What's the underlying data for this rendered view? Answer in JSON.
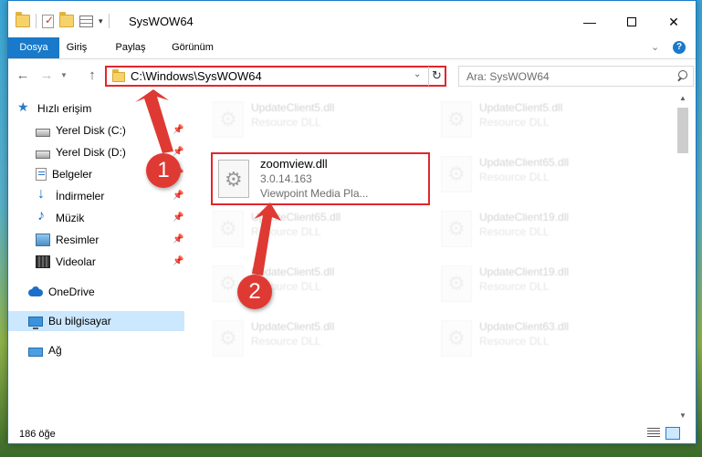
{
  "window": {
    "title": "SysWOW64",
    "controls": {
      "minimize": "—",
      "close": "✕"
    }
  },
  "ribbon": {
    "tabs": [
      {
        "label": "Dosya"
      },
      {
        "label": "Giriş"
      },
      {
        "label": "Paylaş"
      },
      {
        "label": "Görünüm"
      }
    ],
    "help": "?"
  },
  "address": {
    "path": "C:\\Windows\\SysWOW64"
  },
  "search": {
    "placeholder": "Ara: SysWOW64"
  },
  "sidebar": {
    "items": [
      {
        "label": "Hızlı erişim",
        "icon": "star-icon"
      },
      {
        "label": "Yerel Disk (C:)",
        "icon": "drive-icon",
        "pinned": true
      },
      {
        "label": "Yerel Disk (D:)",
        "icon": "drive-icon",
        "pinned": true
      },
      {
        "label": "Belgeler",
        "icon": "documents-icon",
        "pinned": true
      },
      {
        "label": "İndirmeler",
        "icon": "downloads-icon",
        "pinned": true
      },
      {
        "label": "Müzik",
        "icon": "music-icon",
        "pinned": true
      },
      {
        "label": "Resimler",
        "icon": "pictures-icon",
        "pinned": true
      },
      {
        "label": "Videolar",
        "icon": "videos-icon",
        "pinned": true
      },
      {
        "label": "OneDrive",
        "icon": "onedrive-icon"
      },
      {
        "label": "Bu bilgisayar",
        "icon": "computer-icon",
        "selected": true
      },
      {
        "label": "Ağ",
        "icon": "network-icon"
      }
    ]
  },
  "files": [
    {
      "name": "UpdateClient5.dll",
      "type": "Resource DLL"
    },
    {
      "name": "UpdateClient5.dll",
      "type": "Resource DLL"
    },
    {
      "name": "UpdateClient65.dll",
      "type": "Resource DLL"
    },
    {
      "name": "UpdateClient65.dll",
      "type": "Resource DLL"
    },
    {
      "name": "UpdateClient19.dll",
      "type": "Resource DLL"
    },
    {
      "name": "UpdateClient5.dll",
      "type": "Resource DLL"
    },
    {
      "name": "UpdateClient19.dll",
      "type": "Resource DLL"
    },
    {
      "name": "UpdateClient5.dll",
      "type": "Resource DLL"
    },
    {
      "name": "UpdateClient63.dll",
      "type": "Resource DLL"
    }
  ],
  "highlighted_file": {
    "name": "zoomview.dll",
    "version": "3.0.14.163",
    "description": "Viewpoint Media Pla..."
  },
  "status": {
    "item_count": "186 öğe"
  },
  "annotations": {
    "step1": "1",
    "step2": "2",
    "color": "#de3a33"
  }
}
